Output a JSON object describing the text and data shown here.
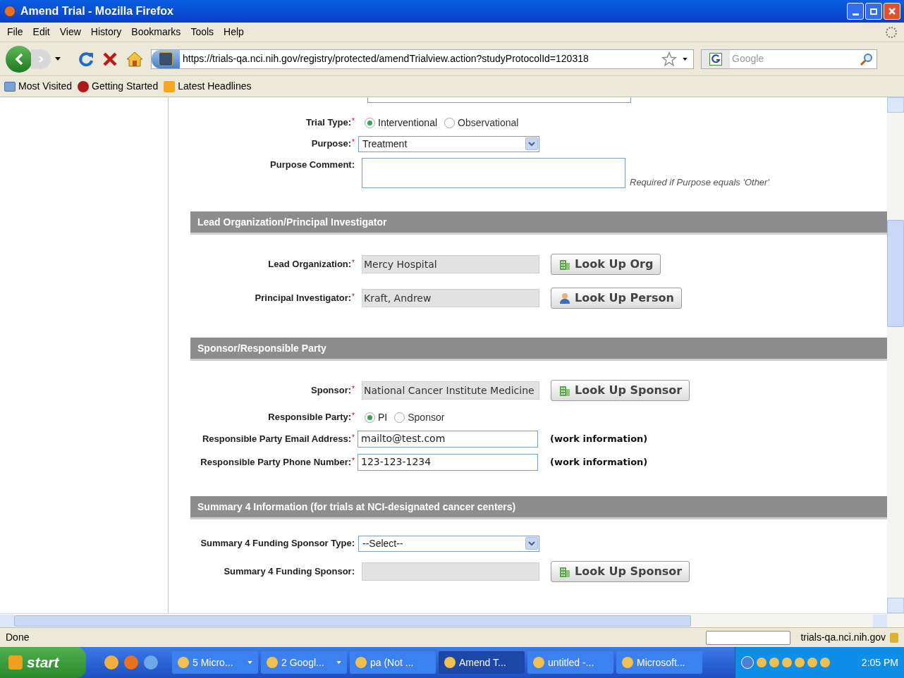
{
  "window": {
    "title": "Amend Trial - Mozilla Firefox"
  },
  "menu": [
    "File",
    "Edit",
    "View",
    "History",
    "Bookmarks",
    "Tools",
    "Help"
  ],
  "toolbar": {
    "url": "https://trials-qa.nci.nih.gov/registry/protected/amendTrialview.action?studyProtocolId=120318",
    "search_placeholder": "Google"
  },
  "bookmarks": [
    {
      "label": "Most Visited",
      "kind": "folder"
    },
    {
      "label": "Getting Started",
      "kind": "page"
    },
    {
      "label": "Latest Headlines",
      "kind": "feed"
    }
  ],
  "top_fields": [
    {
      "kind": "radio",
      "label": "Trial Type:",
      "required_mark": "*",
      "options": [
        {
          "label": "Interventional",
          "selected": true
        },
        {
          "label": "Observational",
          "selected": false
        }
      ]
    },
    {
      "kind": "select",
      "label": "Purpose:",
      "required_mark": "*",
      "value": "Treatment"
    },
    {
      "kind": "textarea",
      "label": "Purpose Comment:",
      "hint": "Required if Purpose equals 'Other'"
    }
  ],
  "sections": [
    {
      "title": "Lead Organization/Principal Investigator",
      "fields": [
        {
          "kind": "readonly",
          "label": "Lead Organization:",
          "required_mark": "*",
          "value": "Mercy Hospital",
          "button": {
            "label": "Look Up Org",
            "kind": "org"
          }
        },
        {
          "kind": "readonly",
          "label": "Principal Investigator:",
          "required_mark": "*",
          "value": "Kraft, Andrew",
          "button": {
            "label": "Look Up Person",
            "kind": "person"
          }
        }
      ]
    },
    {
      "title": "Sponsor/Responsible Party",
      "fields": [
        {
          "kind": "readonly",
          "label": "Sponsor:",
          "required_mark": "*",
          "value": "National Cancer Institute Medicine",
          "button": {
            "label": "Look Up Sponsor",
            "kind": "org"
          }
        },
        {
          "kind": "radio",
          "label": "Responsible Party:",
          "required_mark": "*",
          "options": [
            {
              "label": "PI",
              "selected": true
            },
            {
              "label": "Sponsor",
              "selected": false
            }
          ]
        },
        {
          "kind": "input",
          "label": "Responsible Party Email Address:",
          "required_mark": "*",
          "value": "mailto@test.com",
          "note": "(work information)"
        },
        {
          "kind": "input",
          "label": "Responsible Party Phone Number:",
          "required_mark": "*",
          "value": "123-123-1234",
          "note": "(work information)"
        }
      ]
    },
    {
      "title": "Summary 4 Information (for trials at NCI-designated cancer centers)",
      "fields": [
        {
          "kind": "select",
          "label": "Summary 4 Funding Sponsor Type:",
          "value": "--Select--"
        },
        {
          "kind": "readonly",
          "label": "Summary 4 Funding Sponsor:",
          "button": {
            "label": "Look Up Sponsor",
            "kind": "org"
          }
        }
      ]
    }
  ],
  "status_bar": {
    "text": "Done",
    "host": "trials-qa.nci.nih.gov"
  },
  "taskbar": {
    "start": "start",
    "tasks": [
      {
        "label": "5 Micro...",
        "selected": false,
        "group": true
      },
      {
        "label": "2 Googl...",
        "selected": false,
        "group": true
      },
      {
        "label": "pa (Not ...",
        "selected": false,
        "group": false
      },
      {
        "label": "Amend T...",
        "selected": true,
        "group": false
      },
      {
        "label": "untitled -...",
        "selected": false,
        "group": false
      },
      {
        "label": "Microsoft...",
        "selected": false,
        "group": false
      }
    ],
    "clock": "2:05 PM"
  }
}
